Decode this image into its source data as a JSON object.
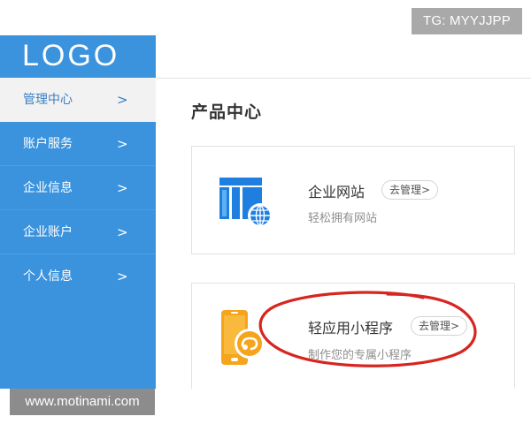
{
  "watermark": {
    "tg": "TG: MYYJJPP",
    "site": "www.motinami.com"
  },
  "sidebar": {
    "logo": "LOGO",
    "items": [
      {
        "label": "管理中心",
        "chevron": ">"
      },
      {
        "label": "账户服务",
        "chevron": ">"
      },
      {
        "label": "企业信息",
        "chevron": ">"
      },
      {
        "label": "企业账户",
        "chevron": ">"
      },
      {
        "label": "个人信息",
        "chevron": ">"
      }
    ],
    "active_index": 0
  },
  "main": {
    "title": "产品中心",
    "products": [
      {
        "title": "企业网站",
        "button": "去管理>",
        "subtitle": "轻松拥有网站",
        "icon": "website-globe-icon"
      },
      {
        "title": "轻应用小程序",
        "button": "去管理>",
        "subtitle": "制作您的专属小程序",
        "icon": "mobile-miniprogram-icon"
      }
    ]
  },
  "colors": {
    "sidebar": "#3b93de",
    "active_bg": "#f2f2f2",
    "annotation_circle": "#d7251f",
    "icon_blue": "#1e7fe0",
    "icon_orange": "#f5a41b"
  }
}
